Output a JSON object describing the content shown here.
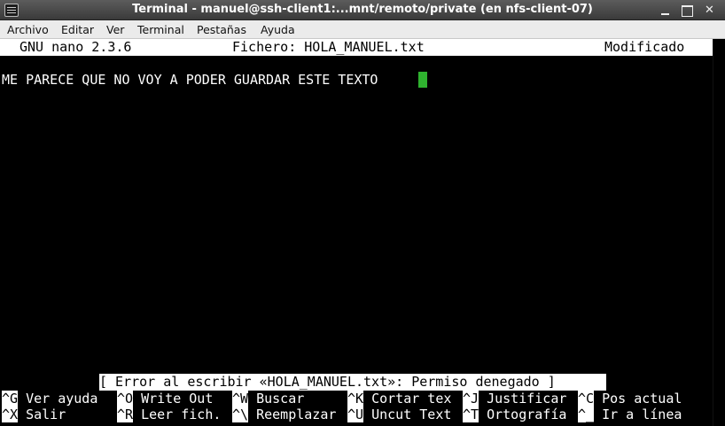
{
  "window": {
    "title": "Terminal - manuel@ssh-client1:...mnt/remoto/private (en nfs-client-07)"
  },
  "menu": [
    "Archivo",
    "Editar",
    "Ver",
    "Terminal",
    "Pestañas",
    "Ayuda"
  ],
  "nano": {
    "version": "GNU nano 2.3.6",
    "file": "Fichero: HOLA_MANUEL.txt",
    "state": "Modificado"
  },
  "editor": {
    "content": "ME PARECE QUE NO VOY A PODER GUARDAR ESTE TEXTO"
  },
  "status_message": "[ Error al escribir «HOLA_MANUEL.txt»: Permiso denegado ]",
  "shortcuts": {
    "row1": [
      {
        "key": "^G",
        "label": " Ver ayuda "
      },
      {
        "key": "^O",
        "label": " Write Out "
      },
      {
        "key": "^W",
        "label": " Buscar    "
      },
      {
        "key": "^K",
        "label": " Cortar tex"
      },
      {
        "key": "^J",
        "label": " Justificar"
      },
      {
        "key": "^C",
        "label": " Pos actual"
      }
    ],
    "row2": [
      {
        "key": "^X",
        "label": " Salir     "
      },
      {
        "key": "^R",
        "label": " Leer fich."
      },
      {
        "key": "^\\",
        "label": " Reemplazar"
      },
      {
        "key": "^U",
        "label": " Uncut Text"
      },
      {
        "key": "^T",
        "label": " Ortografía"
      },
      {
        "key": "^_",
        "label": " Ir a línea"
      }
    ]
  },
  "icons": {
    "window_menu": "window-menu-icon",
    "minimize": "minimize-icon",
    "maximize": "maximize-icon",
    "close": "close-icon"
  },
  "colors": {
    "cursor": "#2fb22f",
    "terminal_bg": "#000000",
    "inverse_bg": "#ffffff"
  }
}
